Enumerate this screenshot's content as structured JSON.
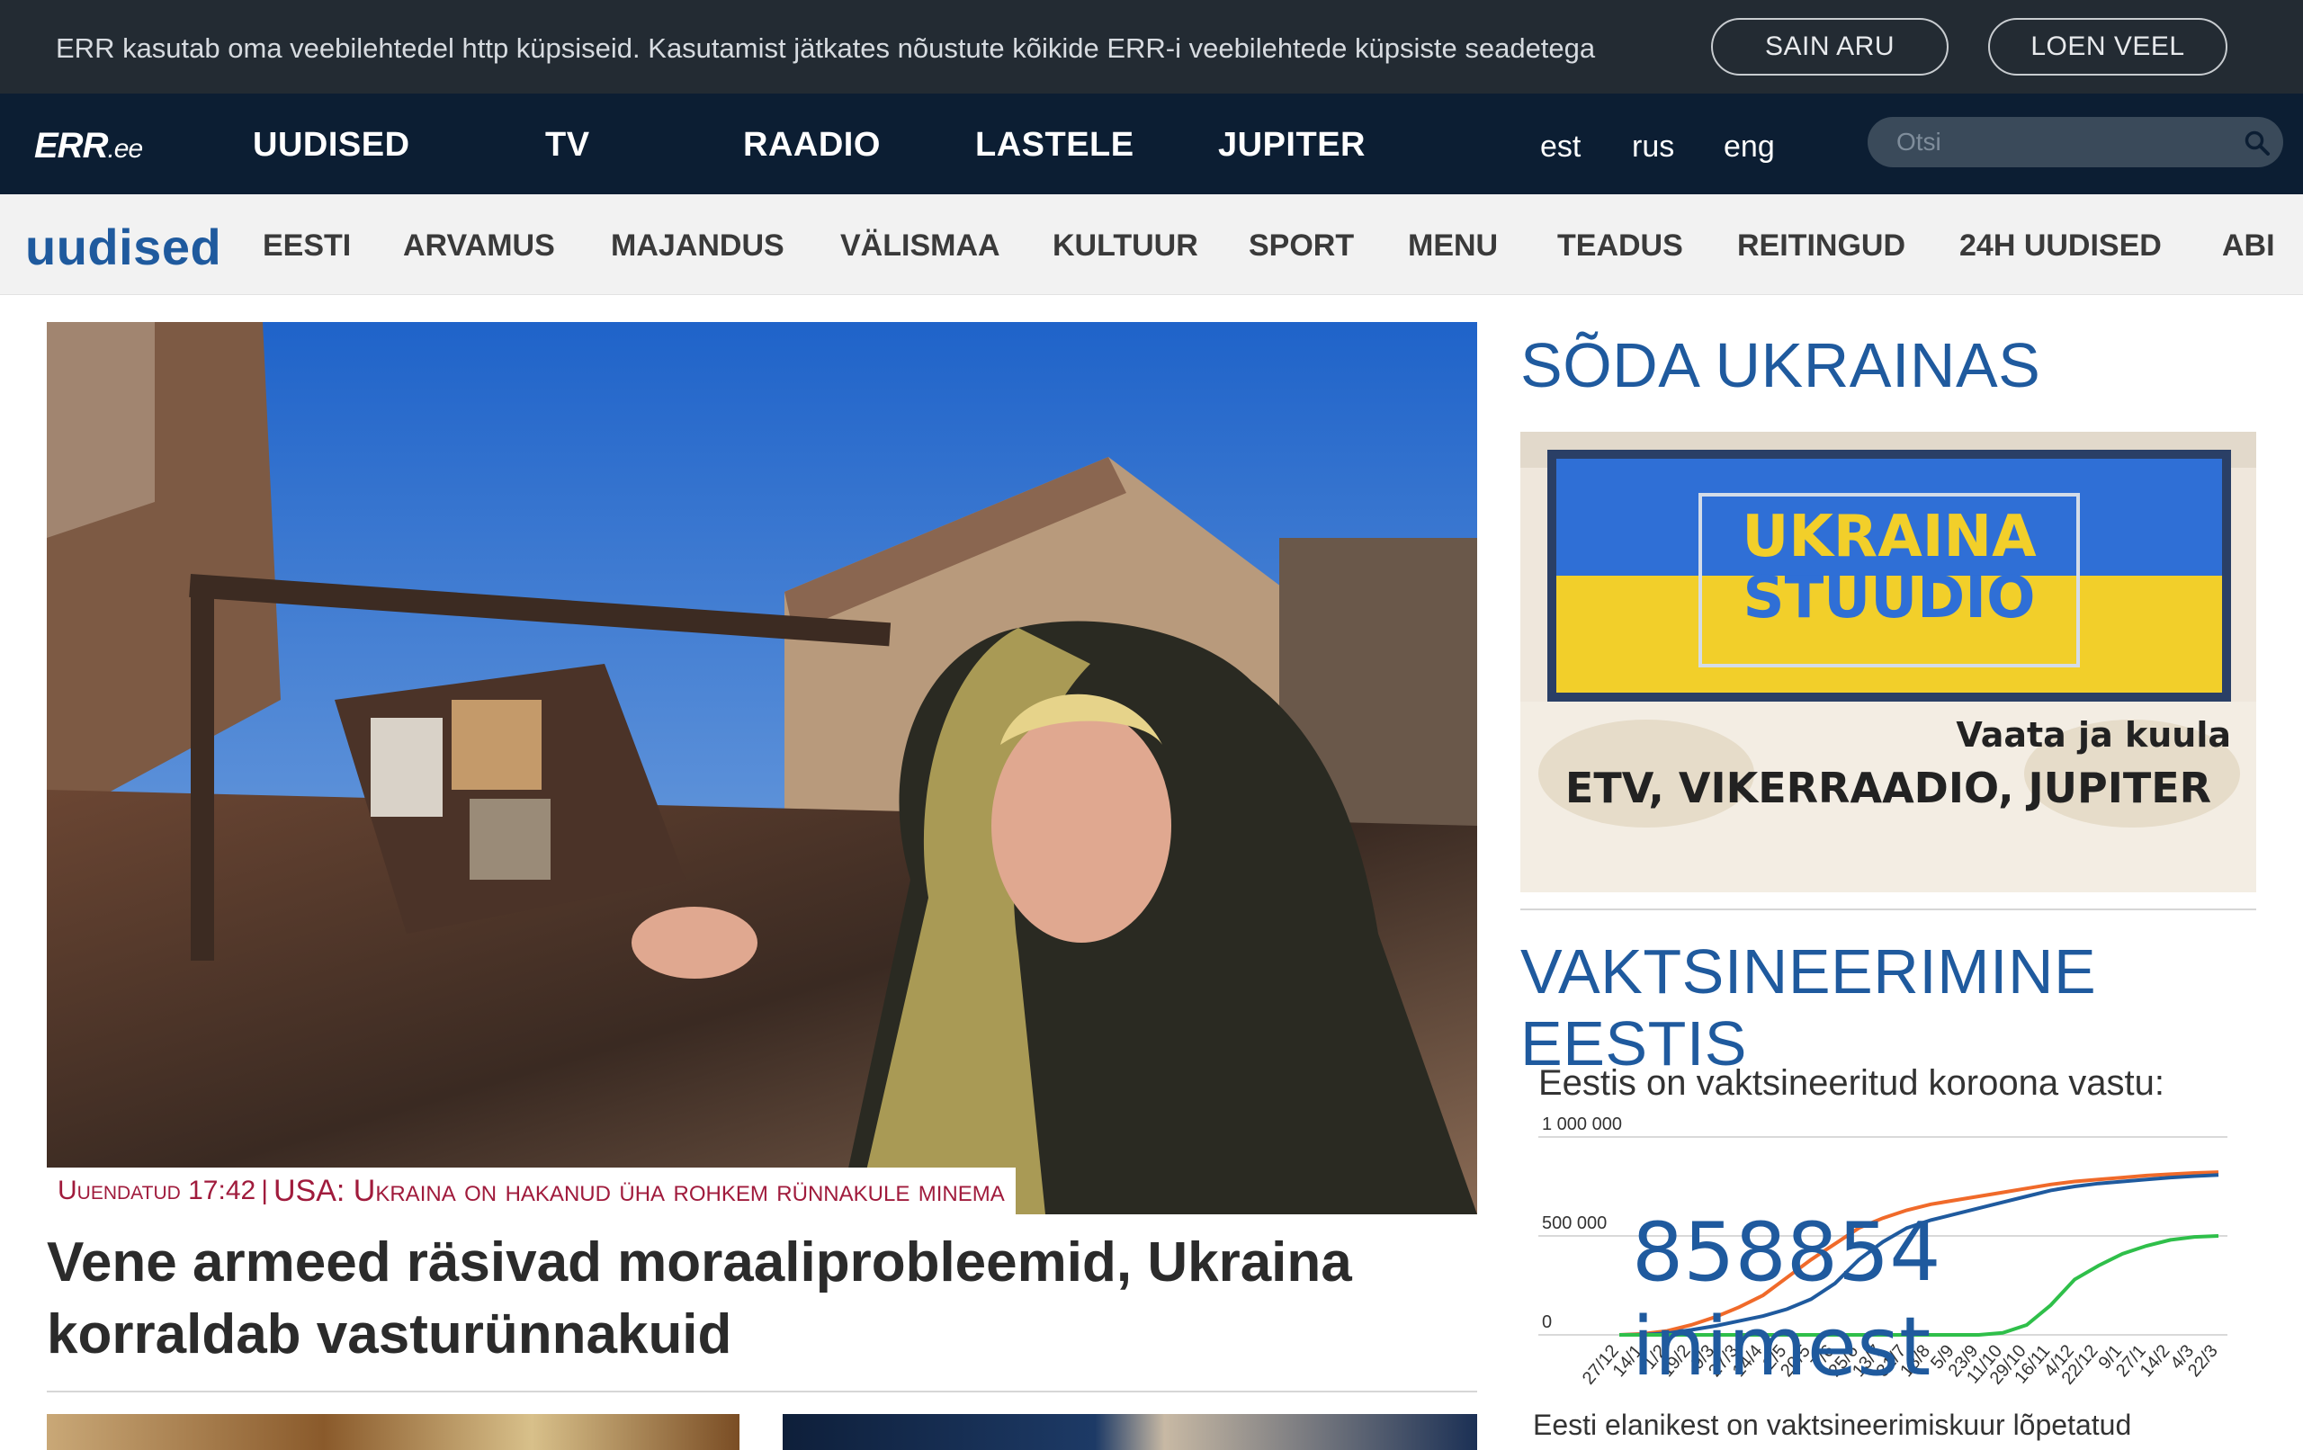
{
  "cookie": {
    "text": "ERR kasutab oma veebilehtedel http küpsiseid. Kasutamist jätkates nõustute kõikide ERR-i veebilehtede küpsiste seadetega",
    "accept_label": "SAIN ARU",
    "more_label": "LOEN VEEL"
  },
  "mainnav": {
    "logo": "ERR",
    "logo_suffix": ".ee",
    "items": [
      "UUDISED",
      "TV",
      "RAADIO",
      "LASTELE",
      "JUPITER"
    ],
    "langs": [
      "est",
      "rus",
      "eng"
    ],
    "search_placeholder": "Otsi"
  },
  "subnav": {
    "brand": "uudised",
    "items": [
      "EESTI",
      "ARVAMUS",
      "MAJANDUS",
      "VÄLISMAA",
      "KULTUUR",
      "SPORT",
      "MENU",
      "TEADUS",
      "REITINGUD",
      "24H UUDISED",
      "ABI"
    ]
  },
  "hero": {
    "updated": "Uuendatud 17:42",
    "separator": "|",
    "tag_text": "USA: Ukraina on hakanud üha rohkem rünnakule minema",
    "headline": "Vene armeed räsivad moraaliprobleemid, Ukraina korraldab vasturünnakuid"
  },
  "sidebar": {
    "war_title": "SÕDA UKRAINAS",
    "promo": {
      "title_line1": "UKRAINA",
      "title_line2": "STUUDIO",
      "sub1": "Vaata ja kuula",
      "sub2": "ETV, VIKERRAADIO, JUPITER"
    },
    "vacc_title": "VAKTSINEERIMINE EESTIS",
    "vacc_label": "Eestis on vaktsineeritud koroona vastu:",
    "vacc_count": "858854 inimest",
    "vacc_footer": "Eesti elanikest on vaktsineerimiskuur lõpetatud"
  },
  "colors": {
    "accent_blue": "#1f5a9e",
    "nav_dark": "#0c1e33",
    "cookie_bg": "#232b33",
    "tag_red": "#a01b3c",
    "series_orange": "#f06a2a",
    "series_blue": "#1f5a9e",
    "series_green": "#2fbf4a"
  },
  "chart_data": {
    "type": "line",
    "y_ticks": [
      "1 000 000",
      "500 000",
      "0"
    ],
    "ylim": [
      0,
      1000000
    ],
    "x": [
      "27/12",
      "14/1",
      "1/2",
      "19/2",
      "9/3",
      "27/3",
      "14/4",
      "2/5",
      "20/5",
      "7/6",
      "25/6",
      "13/7",
      "31/7",
      "18/8",
      "5/9",
      "23/9",
      "11/10",
      "29/10",
      "16/11",
      "4/12",
      "22/12",
      "9/1",
      "27/1",
      "14/2",
      "4/3",
      "22/3"
    ],
    "series": [
      {
        "color": "#f06a2a",
        "values": [
          0,
          5000,
          20000,
          50000,
          90000,
          140000,
          200000,
          290000,
          380000,
          460000,
          540000,
          590000,
          630000,
          660000,
          680000,
          700000,
          720000,
          740000,
          760000,
          775000,
          785000,
          795000,
          805000,
          812000,
          818000,
          822000
        ]
      },
      {
        "color": "#1f5a9e",
        "values": [
          0,
          1000,
          8000,
          25000,
          45000,
          70000,
          95000,
          130000,
          180000,
          260000,
          380000,
          470000,
          540000,
          580000,
          610000,
          640000,
          670000,
          700000,
          730000,
          750000,
          765000,
          775000,
          785000,
          795000,
          802000,
          808000
        ]
      },
      {
        "color": "#2fbf4a",
        "values": [
          0,
          0,
          0,
          0,
          0,
          0,
          0,
          0,
          0,
          0,
          0,
          0,
          0,
          0,
          0,
          0,
          10000,
          50000,
          150000,
          280000,
          350000,
          410000,
          450000,
          480000,
          495000,
          500000
        ]
      }
    ]
  }
}
